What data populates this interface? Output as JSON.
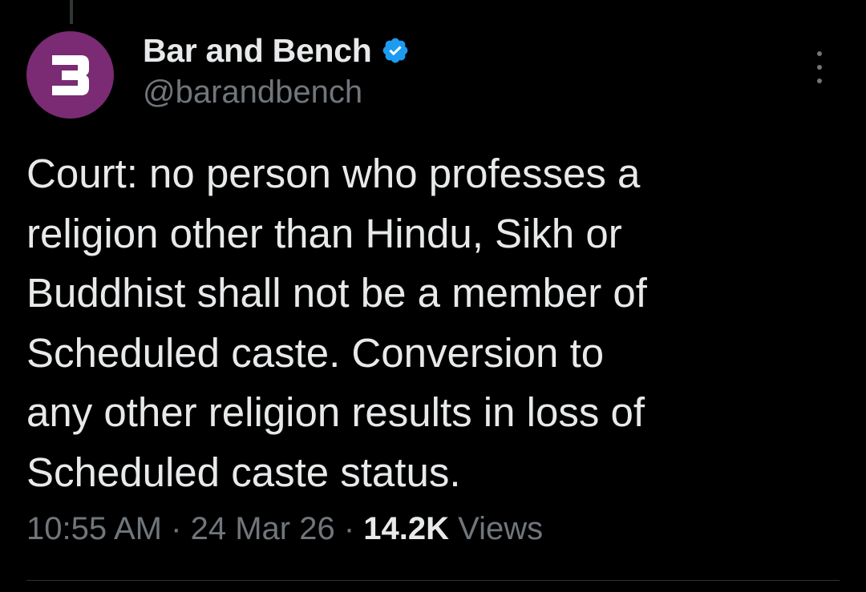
{
  "colors": {
    "background": "#000000",
    "avatar_bg": "#7a2b73",
    "verified_badge": "#1d9bf0",
    "primary_text": "#e7e9ea",
    "secondary_text": "#71767b"
  },
  "author": {
    "avatar_icon": "bar-and-bench-logo",
    "display_name": "Bar and Bench",
    "verified_icon": "verified-badge-icon",
    "handle": "@barandbench"
  },
  "tweet": {
    "text_lines": [
      "Court: no person who professes a",
      "religion other than Hindu, Sikh or",
      "Buddhist shall not be a member of",
      "Scheduled caste. Conversion to",
      "any other religion results in loss of",
      "Scheduled caste status."
    ],
    "time": "10:55 AM",
    "separator": "·",
    "date": "24 Mar 26",
    "view_count": "14.2K",
    "views_label": "Views"
  },
  "menu": {
    "icon": "more-options-icon"
  }
}
